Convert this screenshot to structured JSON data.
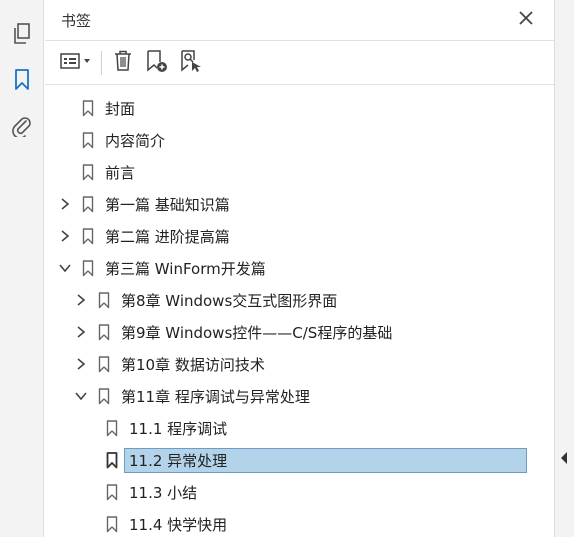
{
  "panel": {
    "title": "书签"
  },
  "icons": {
    "pages": "pages-icon",
    "bookmarks": "bookmark-icon",
    "attachments": "paperclip-icon",
    "close": "close-icon",
    "options": "list-options-icon",
    "delete": "trash-icon",
    "new_bookmark": "add-bookmark-icon",
    "bookmark_from_structure": "bookmark-search-icon"
  },
  "colors": {
    "accent": "#1a73c8",
    "selection_bg": "#b3d3ea",
    "selection_border": "#6f9cbf"
  },
  "bookmarks": [
    {
      "label": "封面",
      "level": 0,
      "expand": "none",
      "selected": false
    },
    {
      "label": "内容简介",
      "level": 0,
      "expand": "none",
      "selected": false
    },
    {
      "label": "前言",
      "level": 0,
      "expand": "none",
      "selected": false
    },
    {
      "label": "第一篇 基础知识篇",
      "level": 0,
      "expand": "collapsed",
      "selected": false
    },
    {
      "label": "第二篇 进阶提高篇",
      "level": 0,
      "expand": "collapsed",
      "selected": false
    },
    {
      "label": "第三篇 WinForm开发篇",
      "level": 0,
      "expand": "expanded",
      "selected": false
    },
    {
      "label": "第8章 Windows交互式图形界面",
      "level": 1,
      "expand": "collapsed",
      "selected": false
    },
    {
      "label": "第9章 Windows控件——C/S程序的基础",
      "level": 1,
      "expand": "collapsed",
      "selected": false
    },
    {
      "label": "第10章 数据访问技术",
      "level": 1,
      "expand": "collapsed",
      "selected": false
    },
    {
      "label": "第11章 程序调试与异常处理",
      "level": 1,
      "expand": "expanded",
      "selected": false
    },
    {
      "label": "11.1 程序调试",
      "level": 2,
      "expand": "none",
      "selected": false
    },
    {
      "label": "11.2 异常处理",
      "level": 2,
      "expand": "none",
      "selected": true
    },
    {
      "label": "11.3 小结",
      "level": 2,
      "expand": "none",
      "selected": false
    },
    {
      "label": "11.4 快学快用",
      "level": 2,
      "expand": "none",
      "selected": false
    }
  ]
}
